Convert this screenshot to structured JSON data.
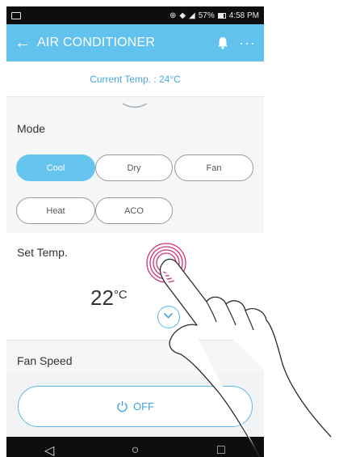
{
  "status_bar": {
    "right_text": "57%",
    "time": "4:58 PM"
  },
  "app_bar": {
    "back_icon": "←",
    "title": "AIR CONDITIONER",
    "more_icon": "···"
  },
  "current_temp": "Current Temp. : 24°C",
  "mode": {
    "label": "Mode",
    "options": [
      "Cool",
      "Dry",
      "Fan",
      "Heat",
      "ACO"
    ],
    "selected": "Cool"
  },
  "set_temp": {
    "label": "Set Temp.",
    "value": "22",
    "unit": "°C"
  },
  "fan_speed": {
    "label": "Fan Speed"
  },
  "power": {
    "label": "OFF"
  },
  "nav": {
    "back": "◁",
    "home": "○",
    "recent": "□"
  },
  "colors": {
    "accent": "#62c2ee",
    "active_pill": "#66c5ef",
    "touch_ring": "#d0327a"
  }
}
